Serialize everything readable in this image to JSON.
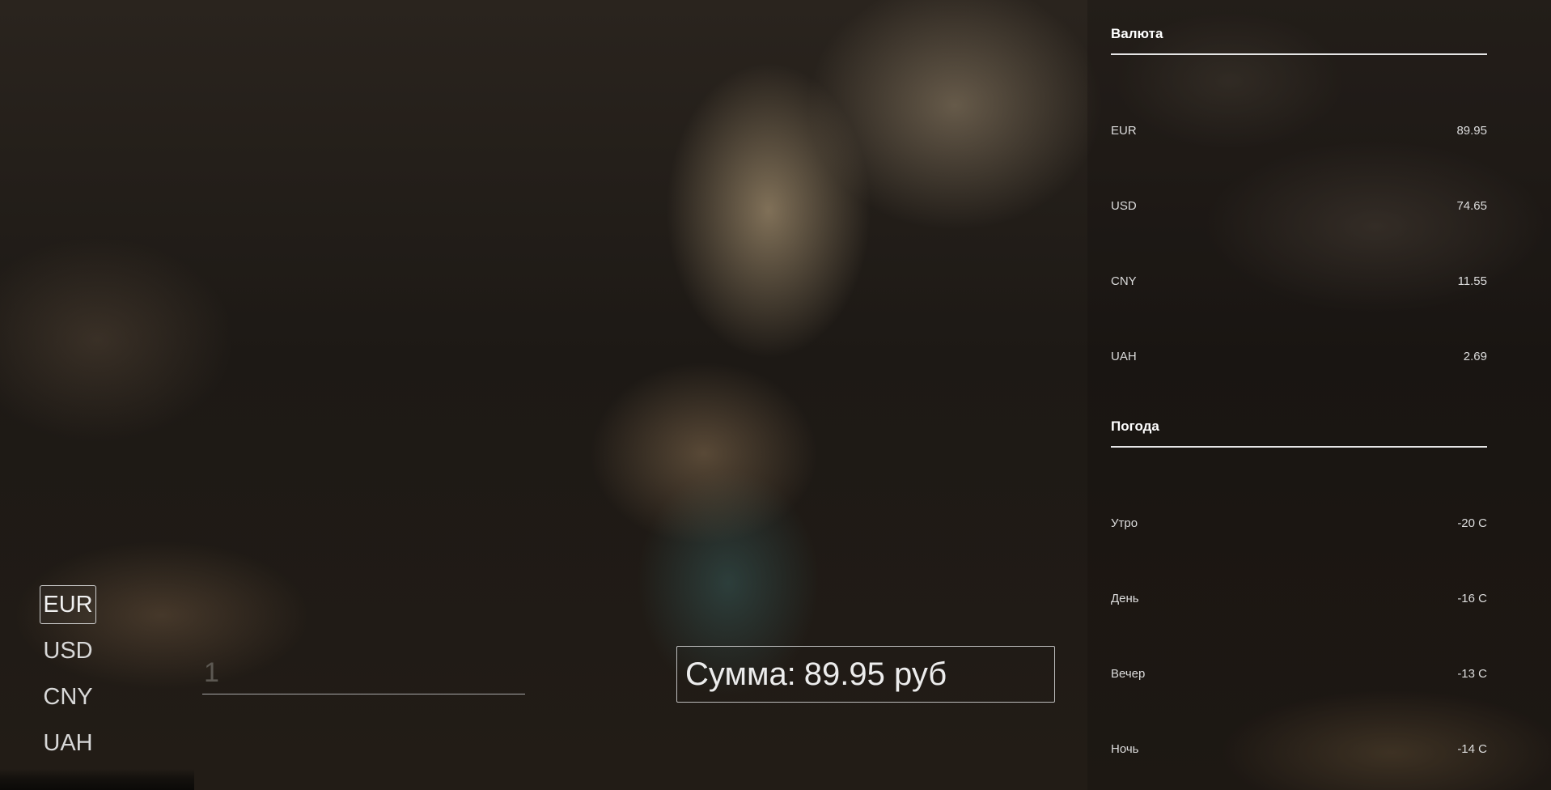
{
  "currency_section": {
    "title": "Валюта",
    "rates": [
      {
        "code": "EUR",
        "value": "89.95"
      },
      {
        "code": "USD",
        "value": "74.65"
      },
      {
        "code": "CNY",
        "value": "11.55"
      },
      {
        "code": "UAH",
        "value": "2.69"
      }
    ]
  },
  "weather_section": {
    "title": "Погода",
    "items": [
      {
        "label": "Утро",
        "value": "-20 C"
      },
      {
        "label": "День",
        "value": "-16 C"
      },
      {
        "label": "Вечер",
        "value": "-13 C"
      },
      {
        "label": "Ночь",
        "value": "-14 C"
      }
    ]
  },
  "converter": {
    "currencies": [
      "EUR",
      "USD",
      "CNY",
      "UAH"
    ],
    "selected": "EUR",
    "amount_placeholder": "1",
    "amount_value": "",
    "result_prefix": "Сумма:",
    "result_value": "89.95",
    "result_unit": "руб"
  },
  "colors": {
    "panel_text": "#dcdcdc",
    "title_text": "#ffffff",
    "underline": "#e6e6e6"
  }
}
